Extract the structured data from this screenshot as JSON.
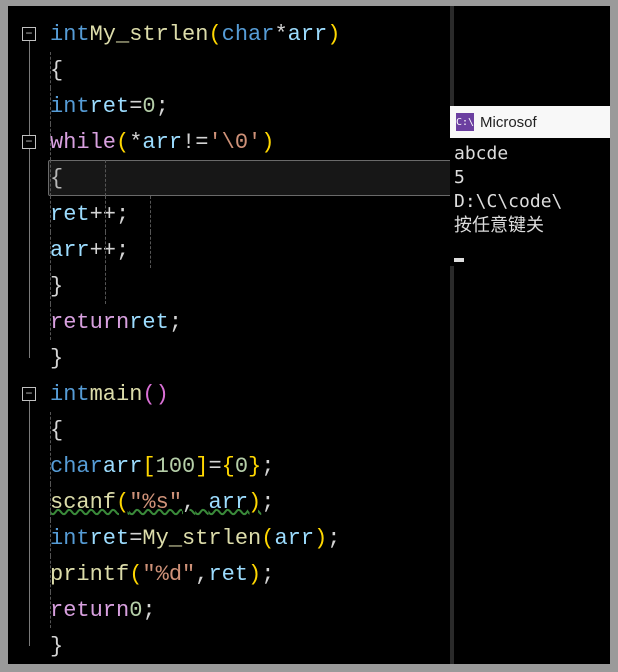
{
  "code": {
    "line1": {
      "type": "int",
      "func": "My_strlen",
      "paren_l": "(",
      "argtype": "char",
      "deref": "*",
      "argname": "arr",
      "paren_r": ")"
    },
    "line2": {
      "brace": "{"
    },
    "line3": {
      "type": "int",
      "var": "ret",
      "op": "=",
      "num": "0",
      "semi": ";"
    },
    "line4": {
      "kw": "while",
      "paren_l": "(",
      "deref": "*",
      "var": "arr",
      "neq": "!=",
      "str": "'\\0'",
      "paren_r": ")"
    },
    "line5": {
      "brace": "{"
    },
    "line6": {
      "var": "ret",
      "op": "++",
      "semi": ";"
    },
    "line7": {
      "var": "arr",
      "op": "++",
      "semi": ";"
    },
    "line8": {
      "brace": "}"
    },
    "line9": {
      "kw": "return",
      "var": "ret",
      "semi": ";"
    },
    "line10": {
      "brace": "}"
    },
    "line11": {
      "type": "int",
      "func": "main",
      "paren_l": "(",
      "paren_r": ")"
    },
    "line12": {
      "brace": "{"
    },
    "line13": {
      "type": "char",
      "var": "arr",
      "br_l": "[",
      "num": "100",
      "br_r": "]",
      "op": "=",
      "bl": "{",
      "zero": "0",
      "br": "}",
      "semi": ";"
    },
    "line14": {
      "func": "scanf",
      "paren_l": "(",
      "str": "\"%s\"",
      "comma": ",",
      "var": "arr",
      "paren_r": ")",
      "semi": ";"
    },
    "line15": {
      "type": "int",
      "var": "ret",
      "op": "=",
      "func": "My_strlen",
      "paren_l": "(",
      "arg": "arr",
      "paren_r": ")",
      "semi": ";"
    },
    "line16": {
      "func": "printf",
      "paren_l": "(",
      "str": "\"%d\"",
      "comma": ",",
      "var": "ret",
      "paren_r": ")",
      "semi": ";"
    },
    "line17": {
      "kw": "return",
      "num": "0",
      "semi": ";"
    },
    "line18": {
      "brace": "}"
    }
  },
  "console": {
    "title": "Microsof",
    "icon": "C:\\",
    "lines": [
      "abcde",
      "5",
      "D:\\C\\code\\",
      "按任意键关"
    ]
  }
}
